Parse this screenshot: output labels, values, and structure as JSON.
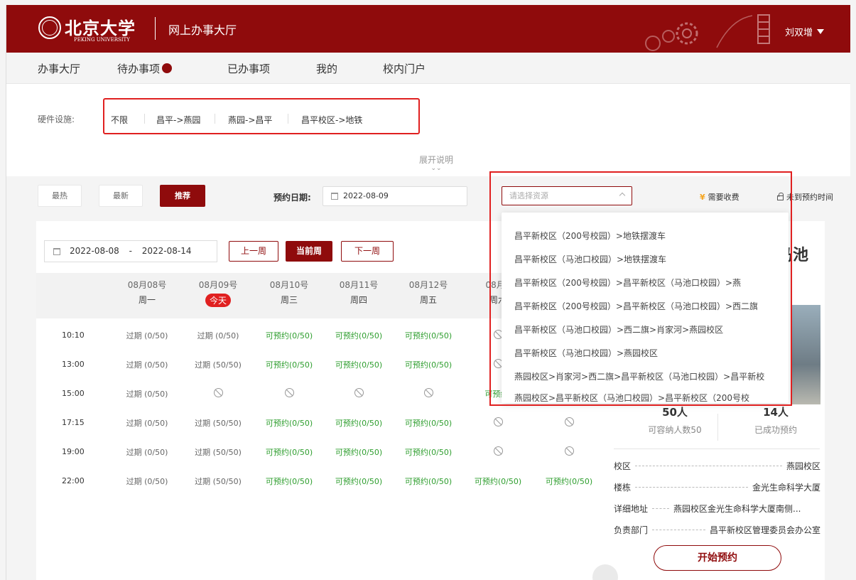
{
  "header": {
    "logo_cn": "北京大学",
    "logo_en": "PEKING UNIVERSITY",
    "app_title": "网上办事大厅",
    "user_name": "刘双增",
    "brand_color": "#8f0b0c"
  },
  "nav": {
    "items": [
      "办事大厅",
      "待办事项",
      "已办事项",
      "我的",
      "校内门户"
    ]
  },
  "filter": {
    "label": "硬件设施:",
    "options": [
      "不限",
      "昌平->燕园",
      "燕园->昌平",
      "昌平校区->地铁"
    ],
    "expand": "展开说明",
    "expand_icon": "chevron-double-down-icon"
  },
  "toolbar": {
    "sort_options": [
      "最热",
      "最新",
      "推荐"
    ],
    "active_sort": "推荐",
    "date_label": "预约日期:",
    "date_value": "2022-08-09",
    "resource_placeholder": "请选择资源",
    "fee_icon": "¥",
    "fee_label": "需要收费",
    "unopen_label": "未到预约时间"
  },
  "dropdown": {
    "items": [
      "昌平新校区（200号校园）>地铁摆渡车",
      "昌平新校区（马池口校园）>地铁摆渡车",
      "昌平新校区（200号校园）>昌平新校区（马池口校园）>燕",
      "昌平新校区（200号校园）>昌平新校区（马池口校园）>西二旗",
      "昌平新校区（马池口校园）>西二旗>肖家河>燕园校区",
      "昌平新校区（马池口校园）>燕园校区",
      "燕园校区>肖家河>西二旗>昌平新校区（马池口校园）>昌平新校",
      "燕园校区>昌平新校区（马池口校园）>昌平新校区（200号校"
    ]
  },
  "week": {
    "range_start": "2022-08-08",
    "range_sep": "-",
    "range_end": "2022-08-14",
    "prev": "上一周",
    "current": "当前周",
    "next": "下一周"
  },
  "table": {
    "dates": [
      "08月08号",
      "08月09号",
      "08月10号",
      "08月11号",
      "08月12号",
      "08月1"
    ],
    "weekdays": [
      "周一",
      "今天",
      "周三",
      "周四",
      "周五",
      "周六"
    ],
    "rows": [
      {
        "time": "10:10",
        "cells": [
          "过期 (0/50)",
          "过期 (0/50)",
          "可预约(0/50)",
          "可预约(0/50)",
          "可预约(0/50)",
          "",
          ""
        ]
      },
      {
        "time": "13:00",
        "cells": [
          "过期 (0/50)",
          "过期 (50/50)",
          "可预约(0/50)",
          "可预约(0/50)",
          "可预约(0/50)",
          "",
          ""
        ]
      },
      {
        "time": "15:00",
        "cells": [
          "过期 (0/50)",
          "",
          "",
          "",
          "",
          "可预约(",
          ""
        ]
      },
      {
        "time": "17:15",
        "cells": [
          "过期 (0/50)",
          "过期 (50/50)",
          "可预约(0/50)",
          "可预约(0/50)",
          "可预约(0/50)",
          "",
          ""
        ]
      },
      {
        "time": "19:00",
        "cells": [
          "过期 (0/50)",
          "过期 (50/50)",
          "可预约(0/50)",
          "可预约(0/50)",
          "可预约(0/50)",
          "",
          ""
        ]
      },
      {
        "time": "22:00",
        "cells": [
          "过期 (0/50)",
          "过期 (50/50)",
          "可预约(0/50)",
          "可预约(0/50)",
          "可预约(0/50)",
          "可预约(0/50)",
          "可预约(0/50)"
        ]
      }
    ],
    "avail_color": "#2e9e2e"
  },
  "side": {
    "title": "马池",
    "capacity_num": "50人",
    "capacity_label": "可容纳人数50",
    "booked_num": "14人",
    "booked_label": "已成功预约",
    "info": [
      {
        "key": "校区",
        "value": "燕园校区"
      },
      {
        "key": "楼栋",
        "value": "金光生命科学大厦"
      },
      {
        "key": "详细地址",
        "value": "燕园校区金光生命科学大厦南侧..."
      },
      {
        "key": "负责部门",
        "value": "昌平新校区管理委员会办公室"
      }
    ],
    "start_button": "开始预约"
  }
}
